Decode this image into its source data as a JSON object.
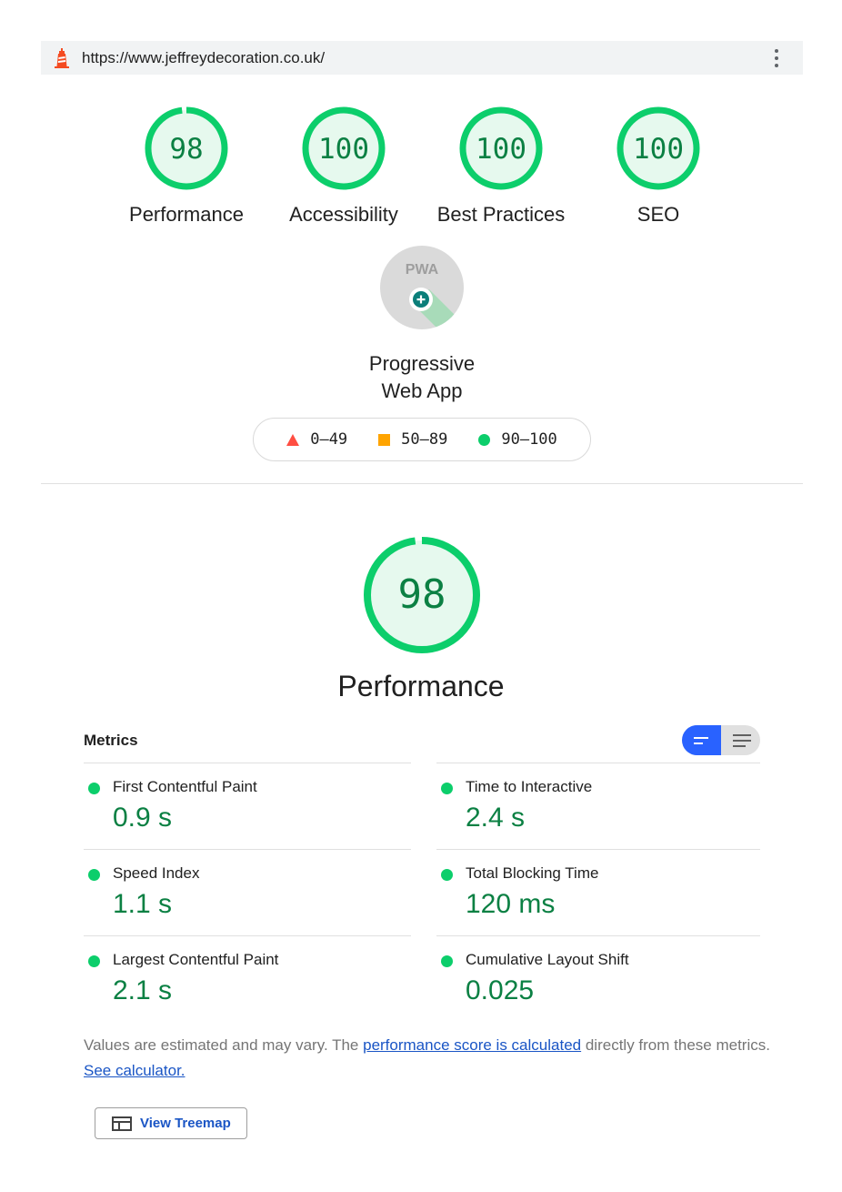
{
  "url_bar": {
    "url": "https://www.jeffreydecoration.co.uk/",
    "lighthouse_icon": "lighthouse-icon",
    "menu_icon": "more-vertical-icon"
  },
  "gauges": [
    {
      "label": "Performance",
      "score": "98",
      "score_value": 98
    },
    {
      "label": "Accessibility",
      "score": "100",
      "score_value": 100
    },
    {
      "label": "Best Practices",
      "score": "100",
      "score_value": 100
    },
    {
      "label": "SEO",
      "score": "100",
      "score_value": 100
    }
  ],
  "pwa": {
    "label_line1": "Progressive",
    "label_line2": "Web App",
    "badge_text": "PWA",
    "icon": "pwa-badge-icon"
  },
  "legend": {
    "fail": "0–49",
    "average": "50–89",
    "pass": "90–100"
  },
  "performance": {
    "score": "98",
    "score_value": 98,
    "title": "Performance"
  },
  "metrics": {
    "heading": "Metrics",
    "left": [
      {
        "name": "First Contentful Paint",
        "value": "0.9 s"
      },
      {
        "name": "Speed Index",
        "value": "1.1 s"
      },
      {
        "name": "Largest Contentful Paint",
        "value": "2.1 s"
      }
    ],
    "right": [
      {
        "name": "Time to Interactive",
        "value": "2.4 s"
      },
      {
        "name": "Total Blocking Time",
        "value": "120 ms"
      },
      {
        "name": "Cumulative Layout Shift",
        "value": "0.025"
      }
    ]
  },
  "note": {
    "text_before": "Values are estimated and may vary. The ",
    "link1": "performance score is calculated",
    "text_middle": " directly from these metrics. ",
    "link2": "See calculator."
  },
  "treemap": {
    "label": "View Treemap",
    "icon": "treemap-icon"
  },
  "colors": {
    "pass": "#0cce6b",
    "pass_text": "#0b8043",
    "average": "#ffa400",
    "fail": "#ff4e42",
    "toggle_active": "#2962ff",
    "link": "#1a55c5"
  }
}
